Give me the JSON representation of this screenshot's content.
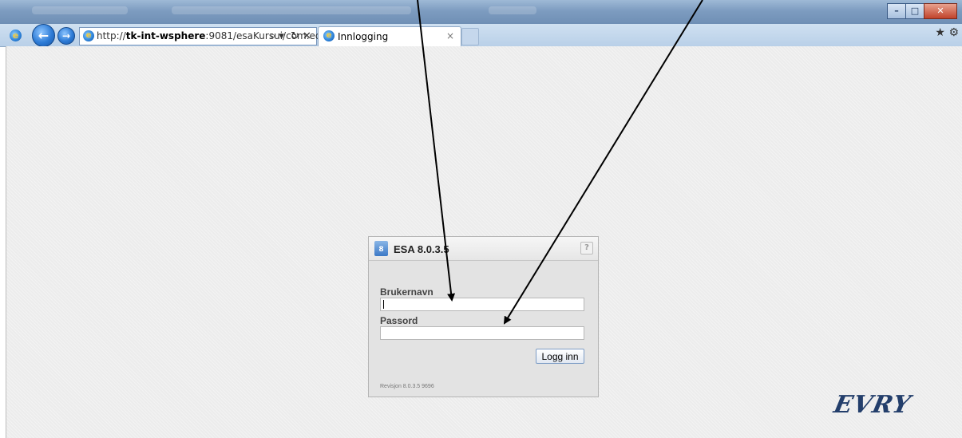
{
  "browser": {
    "address_scheme": "http://",
    "address_host": "tk-int-wsphere",
    "address_rest": ":9081/esaKursui/com.ed",
    "tab_title": "Innlogging",
    "tab_close": "×",
    "search_tool": "⌕ ▾",
    "refresh_tool": "↻",
    "stop_tool": "✕",
    "back_label": "←",
    "forward_label": "→",
    "favorites_icon": "★",
    "tools_icon": "⚙",
    "minimize": "–",
    "maximize": "□",
    "close": "✕"
  },
  "login": {
    "app_badge": "8",
    "title": "ESA 8.0.3.5",
    "help": "?",
    "username_label": "Brukernavn",
    "username_value": "",
    "password_label": "Passord",
    "password_value": "",
    "submit_label": "Logg inn",
    "revision": "Revisjon 8.0.3.5 9696"
  },
  "branding": {
    "logo_text": "EVRY",
    "logo_color": "#233e6b"
  },
  "colors": {
    "titlebar": "#7d9cc0",
    "page_bg": "#ececec",
    "accent": "#2d7bd6"
  }
}
